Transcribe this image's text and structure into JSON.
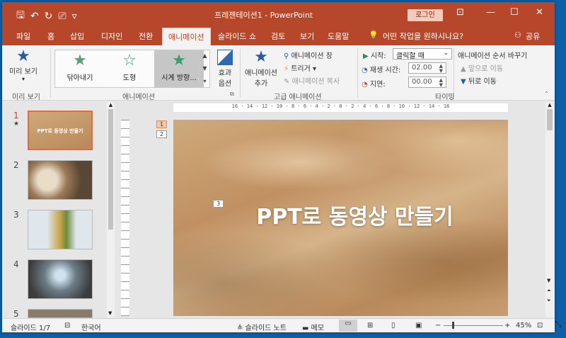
{
  "window": {
    "title": "프레젠테이션1  -  PowerPoint",
    "login": "로그인"
  },
  "tabs": [
    "파일",
    "홈",
    "삽입",
    "디자인",
    "전환",
    "애니메이션",
    "슬라이드 쇼",
    "검토",
    "보기",
    "도움말",
    "어떤 작업을 원하시나요?",
    "공유"
  ],
  "ribbon": {
    "preview": "미리 보기",
    "preview_group": "미리 보기",
    "gallery": [
      "닦아내기",
      "도형",
      "시계 방향..."
    ],
    "effect_options": [
      "효과",
      "옵션"
    ],
    "anim_group": "애니메이션",
    "add_anim": [
      "애니메이션",
      "추가"
    ],
    "anim_pane": "애니메이션 창",
    "trigger": "트리거",
    "painter": "애니메이션 복사",
    "adv_group": "고급 애니메이션",
    "start_label": "시작:",
    "start_value": "클릭할 때",
    "duration_label": "재생 시간:",
    "duration_value": "02.00",
    "delay_label": "지연:",
    "delay_value": "00.00",
    "reorder": "애니메이션 순서 바꾸기",
    "move_earlier": "앞으로 이동",
    "move_later": "뒤로 이동",
    "timing_group": "타이밍"
  },
  "slides": [
    {
      "num": "1",
      "thumb_text": "PPT로 동영상 만들기",
      "star": "★"
    },
    {
      "num": "2"
    },
    {
      "num": "3"
    },
    {
      "num": "4"
    },
    {
      "num": "5"
    }
  ],
  "ruler_h": "16 · 14 · 12 · 10 · 8 · 6 · 4 · 2 · 0 · 2 · 4 · 6 · 8 · 10 · 12 · 14 · 16",
  "slide": {
    "title": "PPT로 동영상 만들기",
    "tags": [
      "1",
      "2",
      "3"
    ]
  },
  "status": {
    "slide": "슬라이드 1/7",
    "lang": "한국어",
    "notes": "슬라이드 노트",
    "comments": "메모",
    "zoom": "45%"
  }
}
